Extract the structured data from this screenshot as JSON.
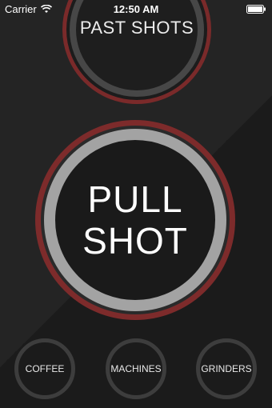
{
  "status_bar": {
    "carrier": "Carrier",
    "time": "12:50 AM",
    "wifi_icon": "wifi-icon",
    "battery_icon": "battery-icon"
  },
  "past_shots": {
    "label": "PAST SHOTS"
  },
  "pull_shot": {
    "line1": "PULL",
    "line2": "SHOT"
  },
  "bottom_nav": {
    "coffee": "COFFEE",
    "machines": "MACHINES",
    "grinders": "GRINDERS"
  },
  "colors": {
    "accent_red": "#7d2b2b",
    "ring_gray": "#a3a3a3",
    "background": "#242424"
  }
}
